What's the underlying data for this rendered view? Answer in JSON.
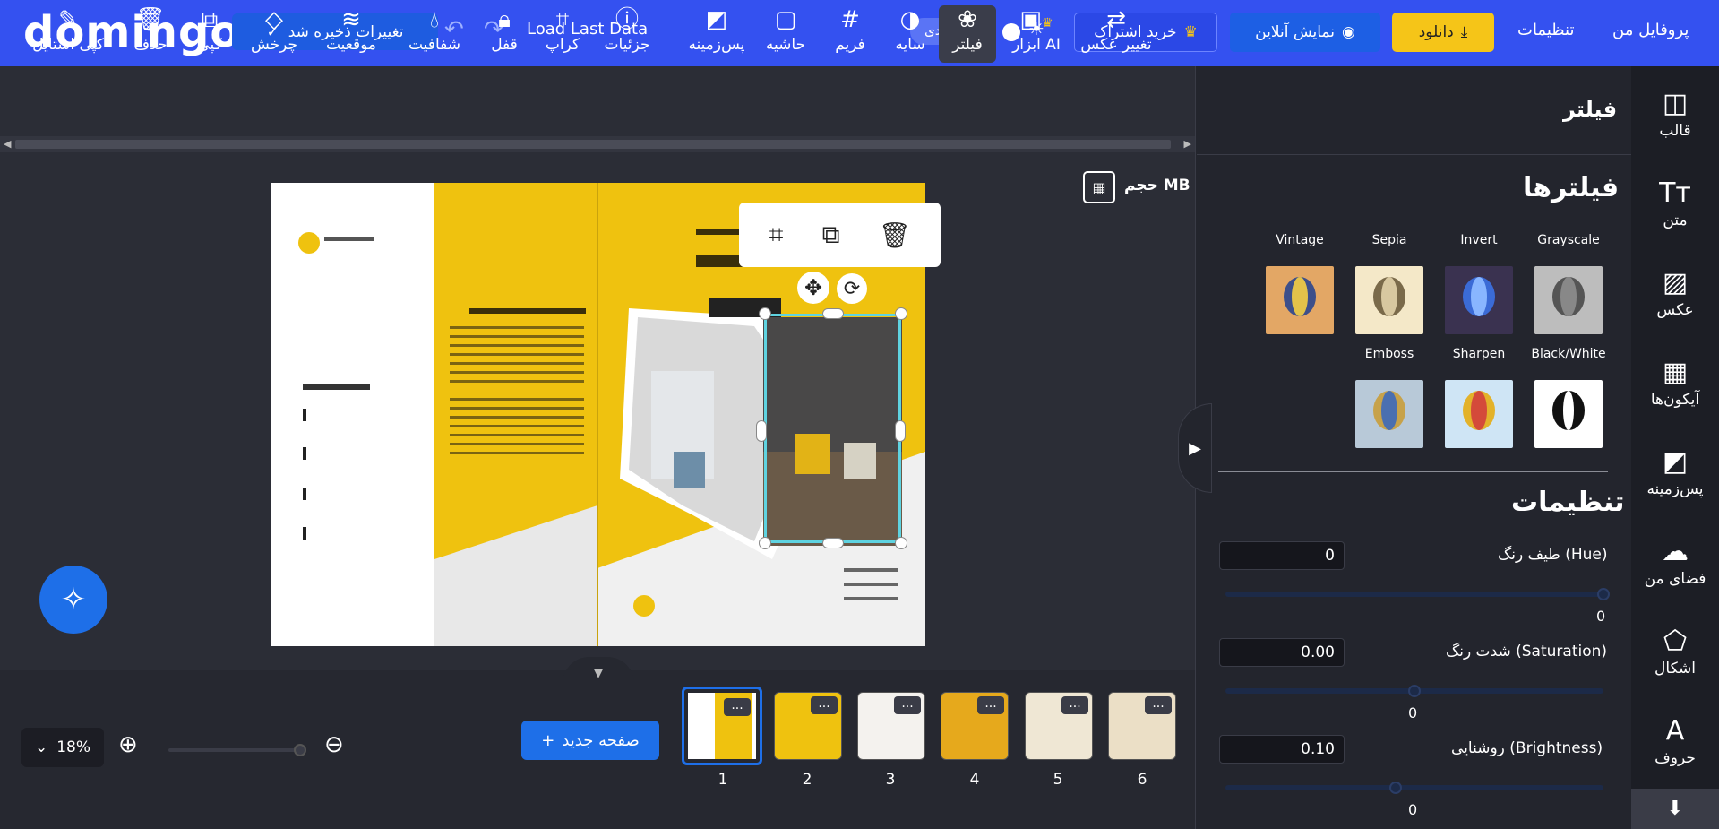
{
  "header": {
    "logo": "domingo",
    "save_label": "تغییرات ذخیره شد",
    "load_last": "Load Last Data",
    "mode_label": "عادی",
    "subscribe_label": "خرید اشتراک",
    "preview_label": "نمایش آنلاین",
    "download_label": "دانلود",
    "settings_label": "تنظیمات",
    "profile_label": "پروفایل من"
  },
  "toolbar": {
    "items": [
      {
        "label": "تغییر عکس",
        "icon": "swap-icon"
      },
      {
        "label": "ابزار AI",
        "icon": "ai-image-icon"
      },
      {
        "label": "فیلتر",
        "icon": "filter-icon"
      },
      {
        "label": "سایه",
        "icon": "shadow-icon"
      },
      {
        "label": "فریم",
        "icon": "frame-icon"
      },
      {
        "label": "حاشیه",
        "icon": "border-icon"
      },
      {
        "label": "پس‌زمینه",
        "icon": "background-icon"
      },
      {
        "label": "جزئیات",
        "icon": "info-icon"
      },
      {
        "label": "کراپ",
        "icon": "crop-icon"
      },
      {
        "label": "قفل",
        "icon": "lock-icon"
      },
      {
        "label": "شفافیت",
        "icon": "opacity-icon"
      },
      {
        "label": "موقعیت",
        "icon": "layers-icon"
      },
      {
        "label": "چرخش",
        "icon": "rotate-icon"
      },
      {
        "label": "کپی",
        "icon": "copy-icon"
      },
      {
        "label": "حذف",
        "icon": "trash-icon"
      },
      {
        "label": "کپی استایل",
        "icon": "brush-icon"
      }
    ]
  },
  "canvas": {
    "size_label": "حجم MB"
  },
  "bottom": {
    "zoom": "18%",
    "new_page_label": "صفحه جدید",
    "pages": [
      "1",
      "2",
      "3",
      "4",
      "5",
      "6"
    ],
    "active_page": "1",
    "dots": "..."
  },
  "panel": {
    "title": "فیلتر",
    "filters_heading": "فیلترها",
    "filters": [
      "Grayscale",
      "Invert",
      "Sepia",
      "Vintage",
      "Black/White",
      "Sharpen",
      "Emboss"
    ],
    "settings_heading": "تنظیمات",
    "sliders": [
      {
        "label": "طیف رنگ (Hue)",
        "value": "0",
        "below": "0",
        "fraction": 1.0
      },
      {
        "label": "شدت رنگ (Saturation)",
        "value": "0.00",
        "below": "0",
        "fraction": 0.5
      },
      {
        "label": "روشنایی (Brightness)",
        "value": "0.10",
        "below": "0",
        "fraction": 0.45
      }
    ]
  },
  "sidebar": {
    "items": [
      {
        "label": "قالب",
        "icon": "template-icon"
      },
      {
        "label": "متن",
        "icon": "text-icon"
      },
      {
        "label": "عکس",
        "icon": "photo-icon"
      },
      {
        "label": "آیکون‌ها",
        "icon": "icons-icon"
      },
      {
        "label": "پس‌زمینه",
        "icon": "background-icon"
      },
      {
        "label": "فضای من",
        "icon": "cloud-upload-icon"
      },
      {
        "label": "اشکال",
        "icon": "shapes-icon"
      },
      {
        "label": "حروف",
        "icon": "font-icon"
      }
    ]
  },
  "colors": {
    "brand": "#3451f0",
    "accent": "#1e6fe8",
    "download": "#f5c518",
    "selection": "#5fd3e0",
    "panel_bg": "#23252d",
    "canvas_bg": "#2b2d36"
  }
}
